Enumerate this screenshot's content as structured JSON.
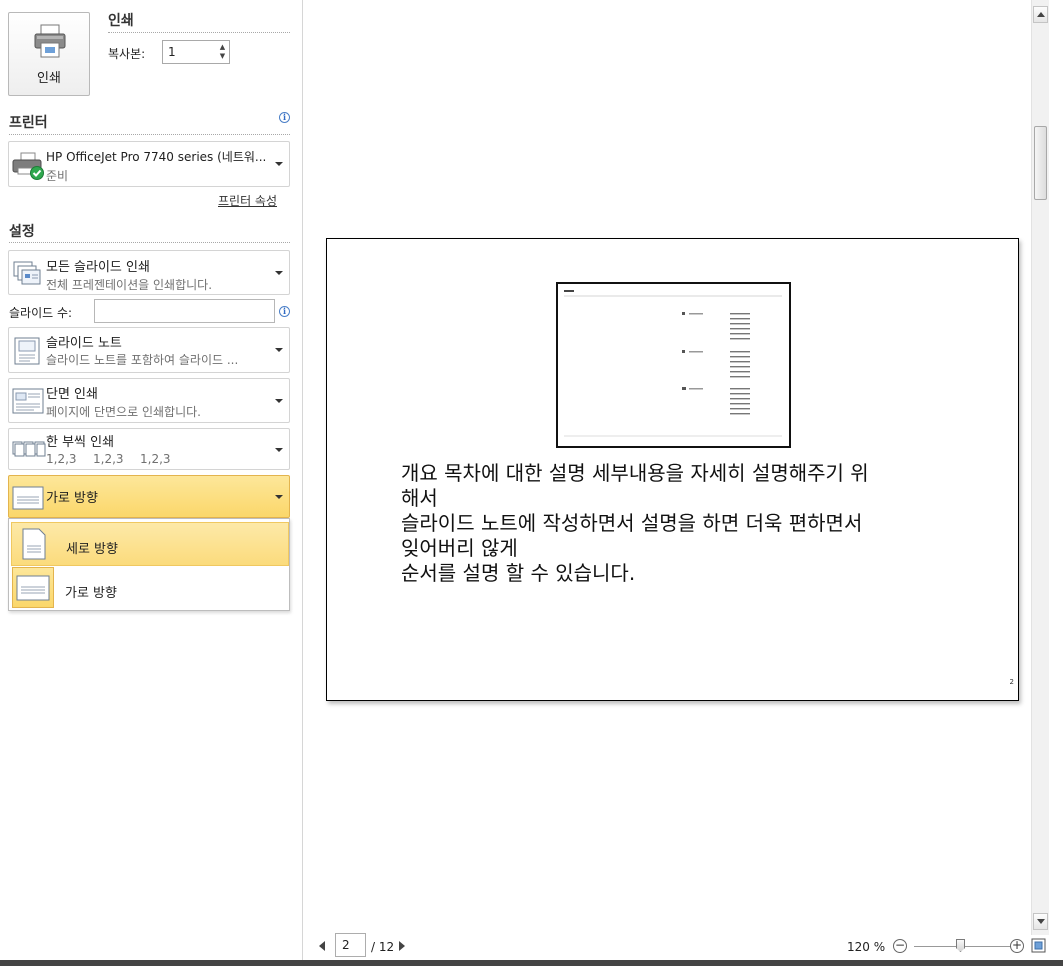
{
  "print": {
    "button_label": "인쇄",
    "section_title": "인쇄",
    "copies_label": "복사본:",
    "copies_value": "1"
  },
  "printer": {
    "section_title": "프린터",
    "name": "HP OfficeJet Pro 7740 series (네트워...",
    "status": "준비",
    "properties_link": "프린터 속성"
  },
  "settings": {
    "section_title": "설정",
    "slides_range": {
      "title": "모든 슬라이드 인쇄",
      "desc": "전체 프레젠테이션을 인쇄합니다."
    },
    "slides_label": "슬라이드 수:",
    "slides_value": "",
    "layout": {
      "title": "슬라이드 노트",
      "desc": "슬라이드 노트를 포함하여 슬라이드 ..."
    },
    "sides": {
      "title": "단면 인쇄",
      "desc": "페이지에 단면으로 인쇄합니다."
    },
    "collate": {
      "title": "한 부씩 인쇄",
      "seq": [
        "1,2,3",
        "1,2,3",
        "1,2,3"
      ]
    },
    "orientation": {
      "selected": "가로 방향",
      "options": [
        "세로 방향",
        "가로 방향"
      ],
      "highlighted_index": 0
    }
  },
  "preview": {
    "note_text": "개요 목차에 대한 설명 세부내용을 자세히 설명해주기 위\n해서\n슬라이드 노트에 작성하면서 설명을 하면 더욱 편하면서\n잊어버리 않게\n순서를 설명 할 수 있습니다.",
    "page_number": "2"
  },
  "navigation": {
    "current_page": "2",
    "total_pages": "/ 12",
    "zoom": "120 %"
  },
  "colors": {
    "active_dropdown": "#fbd76a",
    "highlight": "#fde9a8",
    "accent_check": "#2fa84f"
  }
}
